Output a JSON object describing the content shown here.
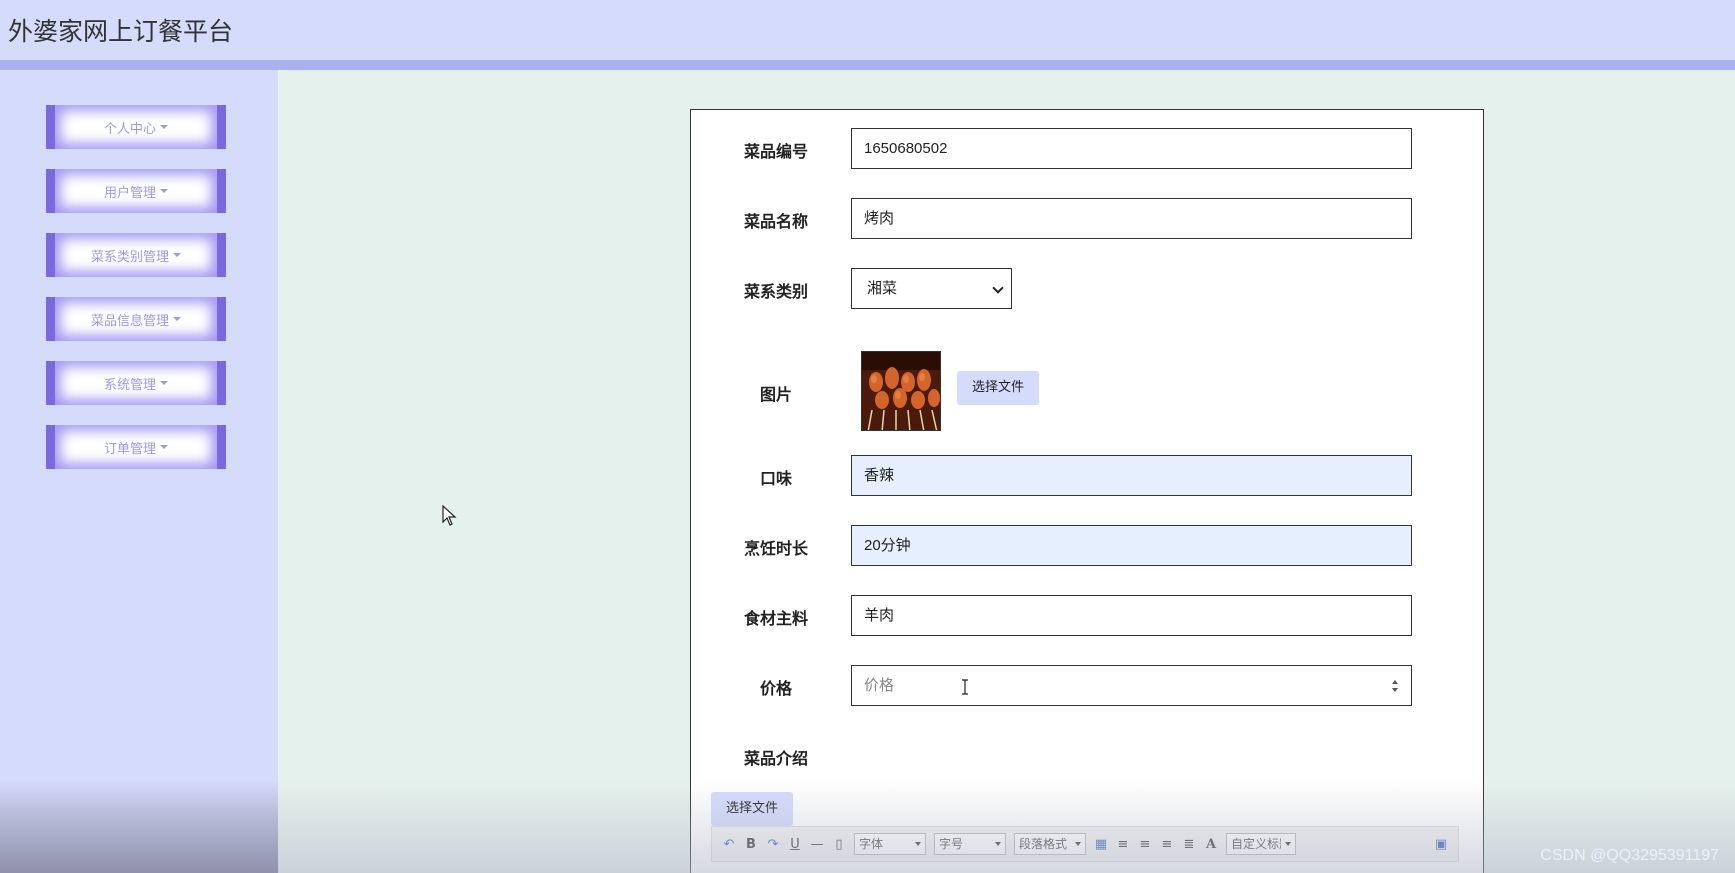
{
  "header": {
    "title": "外婆家网上订餐平台"
  },
  "sidebar": {
    "items": [
      {
        "label": "个人中心"
      },
      {
        "label": "用户管理"
      },
      {
        "label": "菜系类别管理"
      },
      {
        "label": "菜品信息管理"
      },
      {
        "label": "系统管理"
      },
      {
        "label": "订单管理"
      }
    ]
  },
  "form": {
    "dish_no": {
      "label": "菜品编号",
      "value": "1650680502"
    },
    "dish_name": {
      "label": "菜品名称",
      "value": "烤肉"
    },
    "category": {
      "label": "菜系类别",
      "value": "湘菜"
    },
    "image": {
      "label": "图片",
      "button": "选择文件"
    },
    "taste": {
      "label": "口味",
      "value": "香辣"
    },
    "cook_time": {
      "label": "烹饪时长",
      "value": "20分钟"
    },
    "ingredient": {
      "label": "食材主料",
      "value": "羊肉"
    },
    "price": {
      "label": "价格",
      "placeholder": "价格"
    },
    "intro": {
      "label": "菜品介绍",
      "button": "选择文件"
    }
  },
  "editor_toolbar": {
    "font": "字体",
    "size": "字号",
    "paragraph": "段落格式",
    "custom_title": "自定义标题"
  },
  "watermark": "CSDN @QQ3295391197"
}
